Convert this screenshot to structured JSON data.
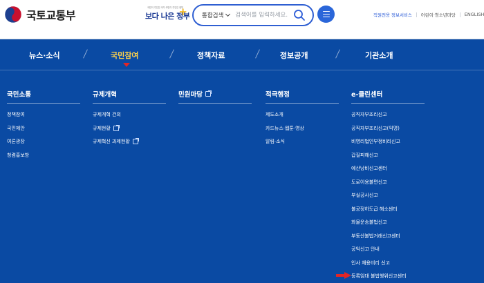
{
  "header": {
    "logo_text": "국토교통부",
    "slogan_sub": "국민이 주인인 국가 국민이 주인인 정부",
    "slogan_main": "보다 나은 정부",
    "search": {
      "scope_label": "통합검색",
      "placeholder": "검색어를 입력하세요."
    },
    "util_links": [
      "직원전용 정보서비스",
      "어린이·청소년마당",
      "ENGLISH"
    ]
  },
  "gnb": {
    "items": [
      "뉴스·소식",
      "국민참여",
      "정책자료",
      "정보공개",
      "기관소개"
    ],
    "active_index": 1
  },
  "columns": [
    {
      "title": "국민소통",
      "external": false,
      "items": [
        {
          "label": "정책참여",
          "external": false
        },
        {
          "label": "국민제안",
          "external": false
        },
        {
          "label": "여론광장",
          "external": false
        },
        {
          "label": "청렴홍보방",
          "external": false
        }
      ]
    },
    {
      "title": "규제개혁",
      "external": false,
      "items": [
        {
          "label": "규제개혁 건의",
          "external": false
        },
        {
          "label": "규제현황",
          "external": true
        },
        {
          "label": "규제혁신 과제현황",
          "external": true
        }
      ]
    },
    {
      "title": "민원마당",
      "external": true,
      "items": []
    },
    {
      "title": "적극행정",
      "external": false,
      "items": [
        {
          "label": "제도소개",
          "external": false
        },
        {
          "label": "카드뉴스·웹툰·영상",
          "external": false
        },
        {
          "label": "알림·소식",
          "external": false
        }
      ]
    },
    {
      "title": "e-클린센터",
      "external": false,
      "items": [
        {
          "label": "공직자부조리신고",
          "external": false
        },
        {
          "label": "공직자부조리신고(익명)",
          "external": false
        },
        {
          "label": "비영리법인부정비리신고",
          "external": false
        },
        {
          "label": "갑질피해신고",
          "external": false
        },
        {
          "label": "예산낭비신고센터",
          "external": false
        },
        {
          "label": "도로이용불편신고",
          "external": false
        },
        {
          "label": "부실공사신고",
          "external": false
        },
        {
          "label": "불공정하도급 해소센터",
          "external": false
        },
        {
          "label": "화물운송불법신고",
          "external": false
        },
        {
          "label": "부동산불법거래신고센터",
          "external": false
        },
        {
          "label": "공익신고 안내",
          "external": false
        },
        {
          "label": "인사 채용비리 신고",
          "external": false
        },
        {
          "label": "등록임대 불법행위신고센터",
          "external": false
        }
      ]
    }
  ],
  "colors": {
    "menu_bg": "#0a4aa3",
    "active": "#ffd24a",
    "accent": "#2a66d9",
    "pointer_red": "#e22525"
  }
}
